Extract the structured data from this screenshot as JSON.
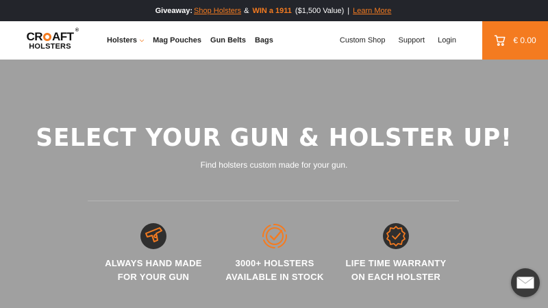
{
  "promo": {
    "label": "Giveaway:",
    "shop_link": "Shop Holsters",
    "amp": "&",
    "highlight": "WIN a 1911",
    "value": "($1,500 Value)",
    "separator": "|",
    "learn_more": "Learn More"
  },
  "logo": {
    "line1_a": "CR",
    "line1_b": "AFT",
    "reg": "®",
    "line2": "HOLSTERS"
  },
  "nav": {
    "items": [
      {
        "label": "Holsters",
        "has_dropdown": true
      },
      {
        "label": "Mag Pouches"
      },
      {
        "label": "Gun Belts"
      },
      {
        "label": "Bags"
      }
    ],
    "right_items": [
      {
        "label": "Custom Shop"
      },
      {
        "label": "Support"
      },
      {
        "label": "Login"
      }
    ]
  },
  "cart": {
    "amount": "€ 0.00",
    "icon": "cart-icon"
  },
  "hero": {
    "title": "SELECT YOUR GUN & HOLSTER UP!",
    "subtitle": "Find holsters custom made for your gun."
  },
  "features": [
    {
      "icon": "gun-icon",
      "line1": "ALWAYS HAND MADE",
      "line2": "FOR YOUR GUN"
    },
    {
      "icon": "checkmark-badge-icon",
      "line1": "3000+ HOLSTERS",
      "line2": "AVAILABLE IN STOCK"
    },
    {
      "icon": "warranty-badge-icon",
      "line1": "LIFE TIME WARRANTY",
      "line2": "ON EACH HOLSTER"
    }
  ],
  "colors": {
    "accent": "#f47b20",
    "dark": "#23252b",
    "hero_bg": "#a0a0a0"
  }
}
